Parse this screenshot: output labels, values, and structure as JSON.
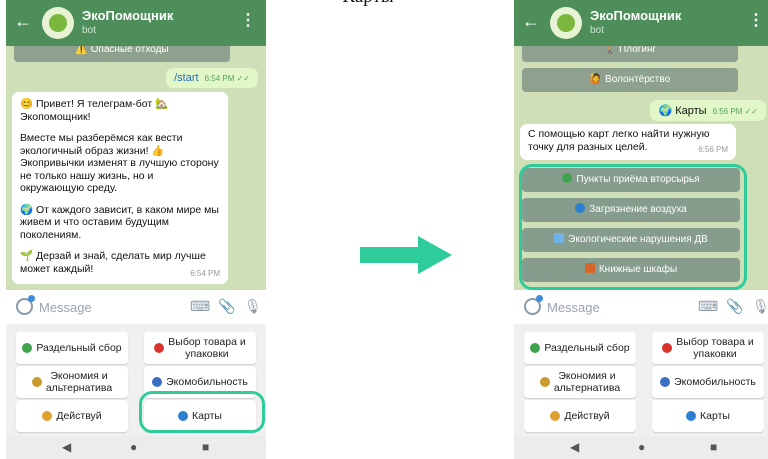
{
  "caption": "Карты",
  "header": {
    "back": "←",
    "title": "ЭкоПомощник",
    "subtitle": "bot",
    "menu": "⋮"
  },
  "screen1": {
    "top_button": "⚠️ Опасные отходы",
    "sent": {
      "text": "/start",
      "time": "6:54 PM ✓✓"
    },
    "message": {
      "p1": "😊 Привет! Я телеграм-бот 🏡 Экопомощник!",
      "p2": "Вместе мы разберёмся как вести экологичный образ жизни! 👍 Экопривычки изменят в лучшую сторону не только нашу жизнь, но и окружающую среду.",
      "p3": "🌍 От каждого зависит, в каком мире мы живем и что оставим будущим поколениям.",
      "p4": "🌱 Дерзай и знай, сделать мир лучше может каждый!",
      "time": "6:54 PM"
    }
  },
  "screen2": {
    "top_buttons": [
      "🚶 Плогинг",
      "🙋 Волонтёрство"
    ],
    "sent": {
      "text": "🌍 Карты",
      "time": "6:56 PM ✓✓"
    },
    "message": {
      "text": "С помощью карт легко найти нужную точку для разных целей.",
      "time": "6:56 PM"
    },
    "inline_buttons": [
      "Пункты приёма вторсырья",
      "Загрязнение воздуха",
      "Экологические нарушения ДВ",
      "Книжные шкафы"
    ]
  },
  "input": {
    "placeholder": "Message"
  },
  "keyboard": [
    {
      "label": "Раздельный сбор",
      "icon": "recycle-icon",
      "color": "#3fa34d"
    },
    {
      "label": "Выбор товара и\nупаковки",
      "icon": "apple-icon",
      "color": "#d9342b"
    },
    {
      "label": "Экономия и\nальтернатива",
      "icon": "money-bag-icon",
      "color": "#c99a2e"
    },
    {
      "label": "Экомобильность",
      "icon": "car-icon",
      "color": "#3a6fc4"
    },
    {
      "label": "Действуй",
      "icon": "hand-icon",
      "color": "#e0a030"
    },
    {
      "label": "Карты",
      "icon": "globe-icon",
      "color": "#2e7fd1"
    }
  ],
  "colors": {
    "highlight": "#2ecc9a",
    "arrow": "#2ecc9a",
    "header": "#4d8e5a",
    "chat_bg": "#cfe0b9"
  }
}
